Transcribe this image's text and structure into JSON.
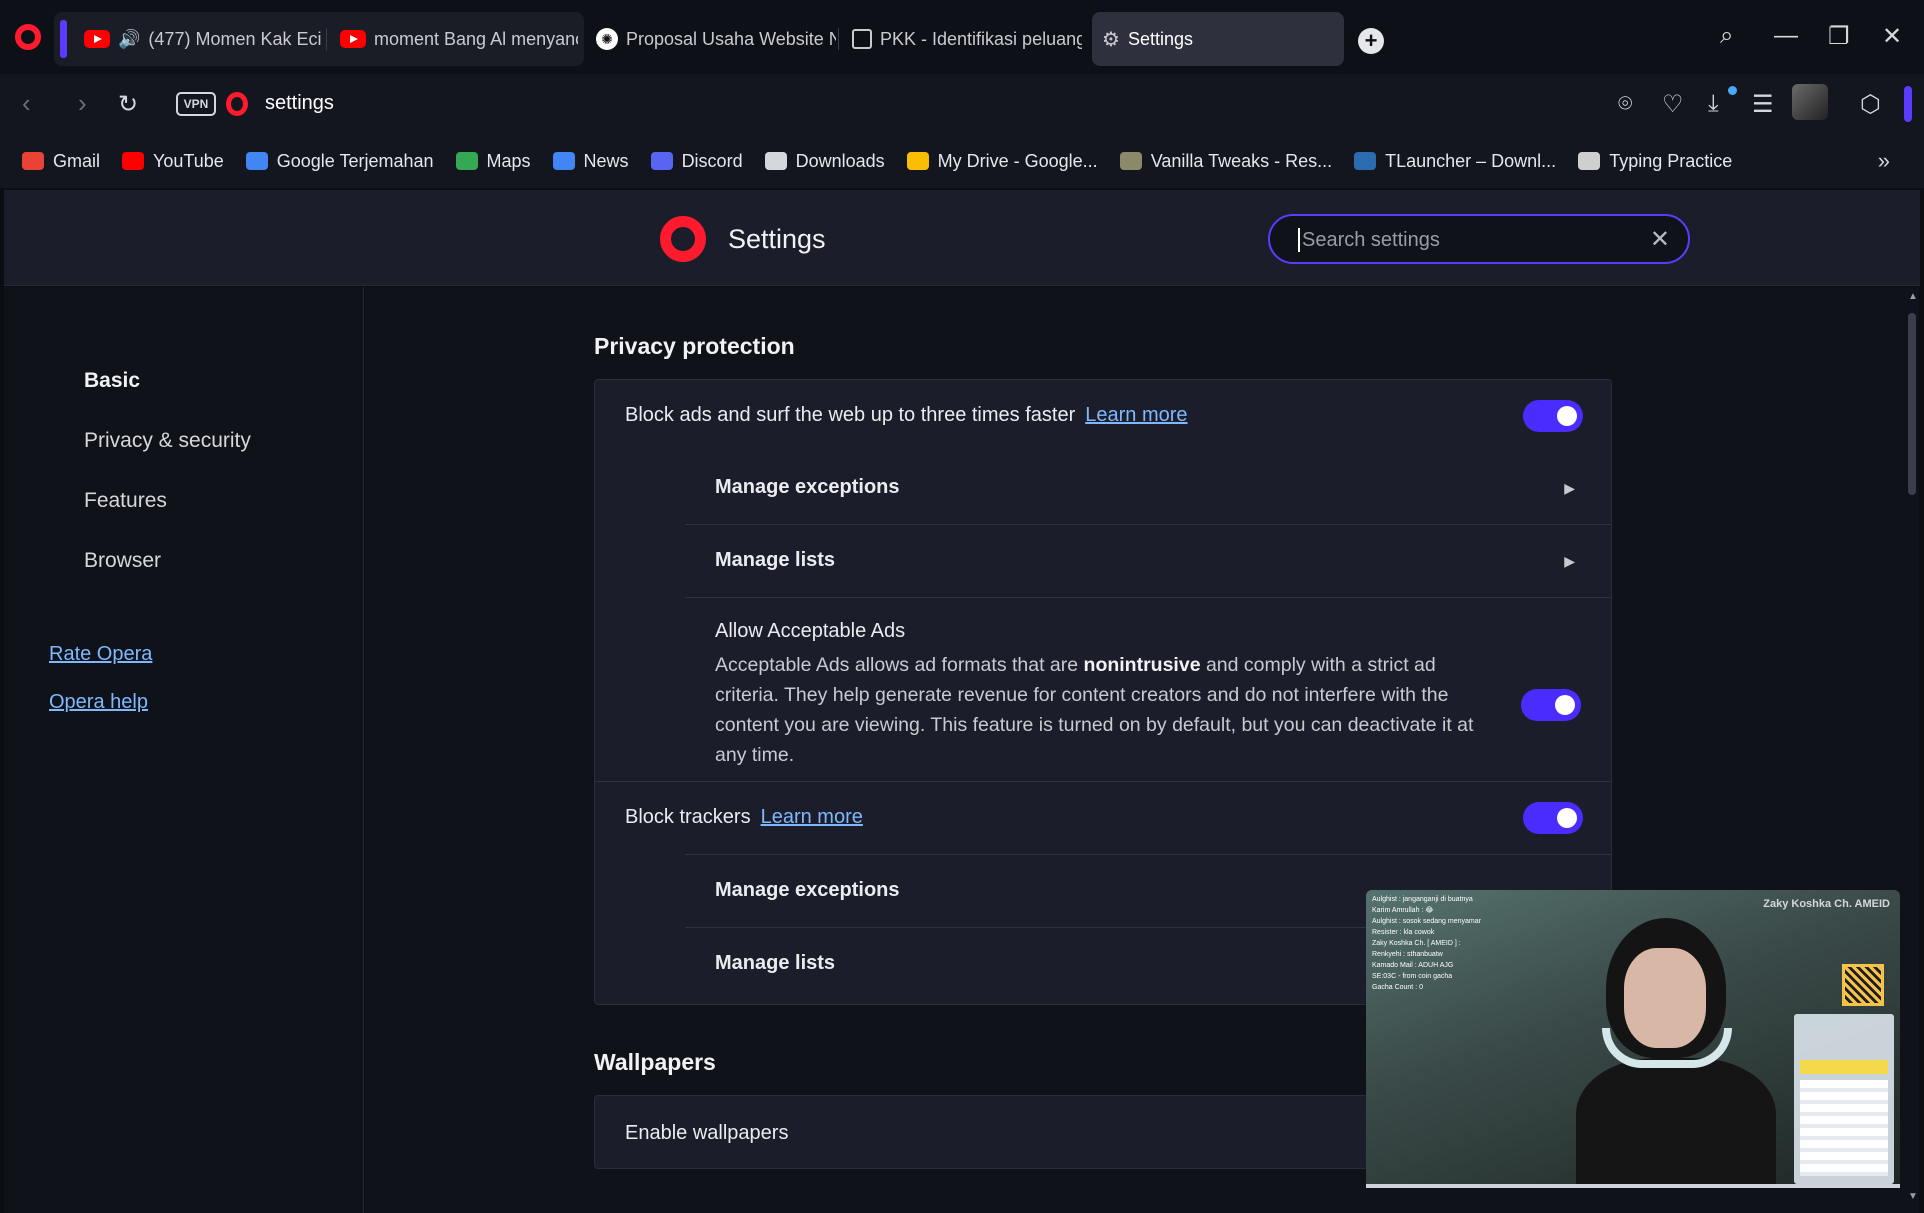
{
  "tabs": [
    {
      "label": "(477) Momen Kak Eci C",
      "icon": "youtube-icon",
      "audio": true
    },
    {
      "label": "moment Bang Al menyanc",
      "icon": "youtube-icon"
    },
    {
      "label": "Proposal Usaha Website N",
      "icon": "chatgpt-icon"
    },
    {
      "label": "PKK - Identifikasi peluang",
      "icon": "document-icon"
    },
    {
      "label": "Settings",
      "icon": "gear-icon",
      "active": true
    }
  ],
  "addressbar": {
    "vpn_label": "VPN",
    "url": "settings"
  },
  "bookmarks": [
    {
      "label": "Gmail",
      "icon": "gmail-icon",
      "color": "#ea4335"
    },
    {
      "label": "YouTube",
      "icon": "youtube-icon",
      "color": "#ff0000"
    },
    {
      "label": "Google Terjemahan",
      "icon": "translate-icon",
      "color": "#4285f4"
    },
    {
      "label": "Maps",
      "icon": "maps-pin-icon",
      "color": "#34a853"
    },
    {
      "label": "News",
      "icon": "news-icon",
      "color": "#4285f4"
    },
    {
      "label": "Discord",
      "icon": "discord-icon",
      "color": "#5865f2"
    },
    {
      "label": "Downloads",
      "icon": "download-icon",
      "color": "#d6d7dc"
    },
    {
      "label": "My Drive - Google...",
      "icon": "drive-icon",
      "color": "#fbbc04"
    },
    {
      "label": "Vanilla Tweaks - Res...",
      "icon": "vanilla-tweaks-icon",
      "color": "#8a8a6a"
    },
    {
      "label": "TLauncher – Downl...",
      "icon": "tlauncher-icon",
      "color": "#2b6cb0"
    },
    {
      "label": "Typing Practice",
      "icon": "typing-practice-icon",
      "color": "#cfcfcf"
    }
  ],
  "header": {
    "title": "Settings",
    "search_placeholder": "Search settings"
  },
  "leftnav": {
    "items": [
      "Basic",
      "Privacy & security",
      "Features",
      "Browser"
    ],
    "active": "Basic",
    "links": [
      "Rate Opera",
      "Opera help"
    ]
  },
  "privacy": {
    "section_title": "Privacy protection",
    "block_ads": {
      "label": "Block ads and surf the web up to three times faster",
      "link": "Learn more",
      "enabled": true
    },
    "manage_exceptions": "Manage exceptions",
    "manage_lists": "Manage lists",
    "acceptable_ads": {
      "title": "Allow Acceptable Ads",
      "desc_before": "Acceptable Ads allows ad formats that are ",
      "desc_bold": "nonintrusive",
      "desc_after": " and comply with a strict ad criteria. They help generate revenue for content creators and do not interfere with the content you are viewing. This feature is turned on by default, but you can deactivate it at any time.",
      "enabled": true
    },
    "block_trackers": {
      "label": "Block trackers",
      "link": "Learn more",
      "enabled": true
    },
    "manage_exceptions_2": "Manage exceptions",
    "manage_lists_2": "Manage lists"
  },
  "wallpapers": {
    "section_title": "Wallpapers",
    "enable_label": "Enable wallpapers"
  },
  "pip": {
    "brand": "Zaky Koshka Ch. AMEID",
    "chat": [
      "Aulghist : janganganji di buatnya",
      "Karim Amrullah : 😂",
      "Aulghist : sosok sedang menyamar",
      "Resister : kla cowok",
      "Zaky Koshka Ch. [ AMEID ] :",
      "Renkyehi : sthanbuatw",
      "Kamado Mail : ADUH AJG",
      "SE:03C - from coin gacha",
      "Gacha Count : 0"
    ]
  },
  "colors": {
    "accent": "#5b3cff",
    "toggle": "#4a2cff",
    "link": "#7fb8ff",
    "opera_red": "#ff1b2d"
  }
}
